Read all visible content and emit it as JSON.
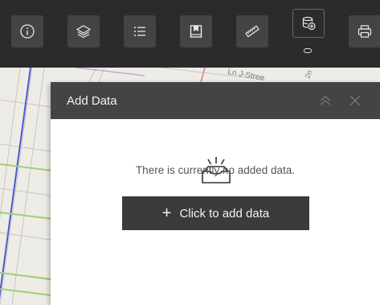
{
  "toolbar": {
    "tools": [
      {
        "name": "info-icon"
      },
      {
        "name": "layers-icon"
      },
      {
        "name": "legend-list-icon"
      },
      {
        "name": "bookmark-icon"
      },
      {
        "name": "measure-ruler-icon"
      },
      {
        "name": "add-data-icon",
        "active": true
      },
      {
        "name": "print-icon"
      }
    ]
  },
  "map": {
    "street_label_1": "Ln J-Stree",
    "street_label_2": "2n"
  },
  "panel": {
    "title": "Add Data",
    "empty_message": "There is currently no added data.",
    "add_button_label": "Click to add data",
    "add_button_icon": "plus-icon",
    "empty_icon": "empty-tray-icon"
  },
  "colors": {
    "toolbar_bg": "#2b2b2b",
    "header_bg": "#444444",
    "button_bg": "#3b3b3b"
  }
}
